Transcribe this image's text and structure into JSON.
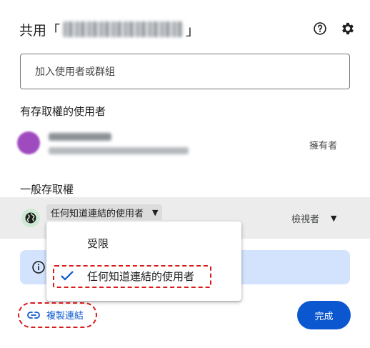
{
  "dialog": {
    "title_prefix": "共用「",
    "title_suffix": "」",
    "help_icon": "help-circle-icon",
    "settings_icon": "gear-icon"
  },
  "add_people": {
    "placeholder": "加入使用者或群組"
  },
  "people_with_access": {
    "heading": "有存取權的使用者",
    "users": [
      {
        "role": "擁有者"
      }
    ]
  },
  "general_access": {
    "heading": "一般存取權",
    "selected": "任何知道連結的使用者",
    "role": "檢視者",
    "options": [
      "受限",
      "任何知道連結的使用者"
    ]
  },
  "footer": {
    "copy_link": "複製連結",
    "done": "完成"
  },
  "colors": {
    "primary": "#0b57d0",
    "info_bg": "#d3e3fd",
    "highlight_dash": "#d81b1b"
  }
}
